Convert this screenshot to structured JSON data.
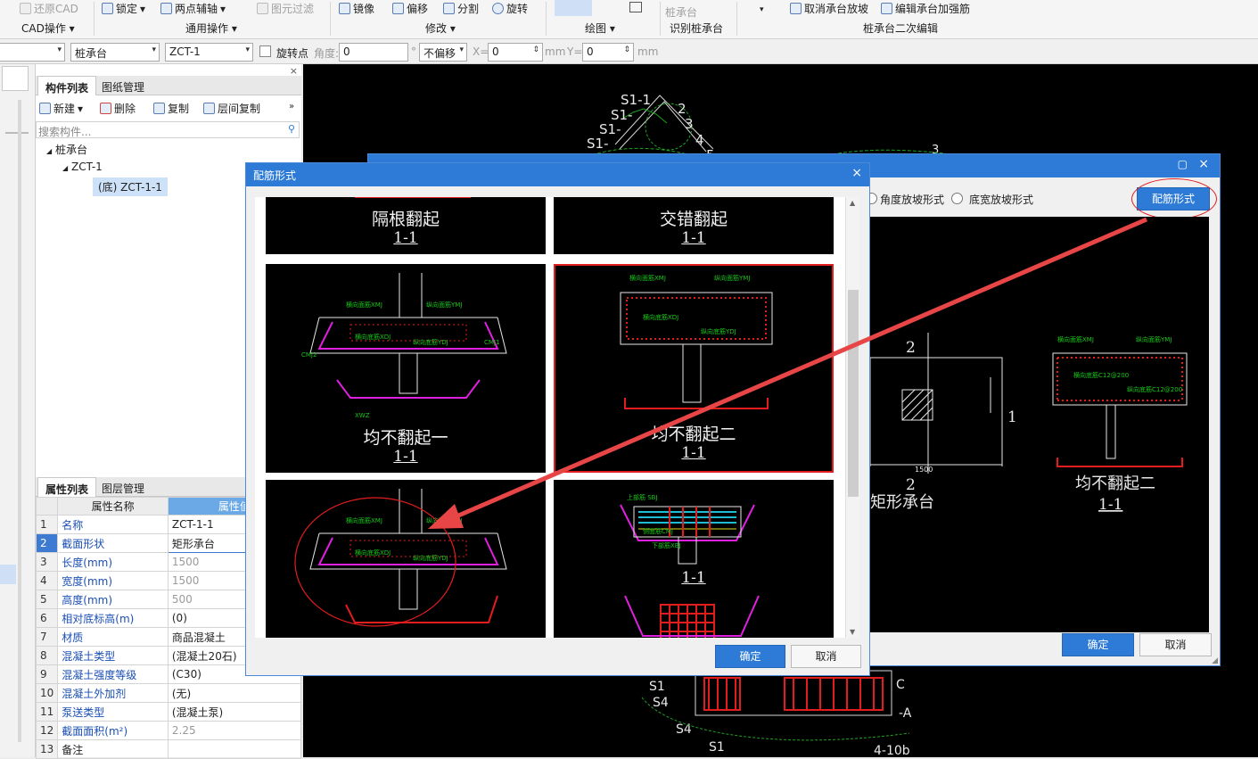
{
  "ribbon": {
    "items": [
      {
        "label": "还原CAD",
        "dim": true
      },
      {
        "label": "锁定",
        "dim": false
      },
      {
        "label": "两点辅轴",
        "dim": false
      },
      {
        "label": "图元过滤",
        "dim": true
      },
      {
        "label": "镜像",
        "dim": false
      },
      {
        "label": "偏移",
        "dim": false
      },
      {
        "label": "分割",
        "dim": false
      },
      {
        "label": "旋转",
        "dim": false
      },
      {
        "label": "桩承台",
        "dim": true
      },
      {
        "label": "取消承台放坡",
        "dim": false
      },
      {
        "label": "编辑承台加强筋",
        "dim": false
      }
    ],
    "groups": [
      "CAD操作",
      "通用操作",
      "修改",
      "绘图",
      "识别桩承台",
      "桩承台二次编辑"
    ]
  },
  "propbar": {
    "layer_combo": "桩承台",
    "comp_combo": "ZCT-1",
    "rotate_label": "旋转点",
    "angle_label": "角度:",
    "angle_value": "0",
    "offset_combo": "不偏移",
    "x_label": "X=",
    "x_value": "0",
    "y_label": "Y=",
    "y_value": "0",
    "unit": "mm"
  },
  "left": {
    "tabs": [
      "构件列表",
      "图纸管理"
    ],
    "toolbar": {
      "new": "新建",
      "delete": "删除",
      "copy": "复制",
      "floor_copy": "层间复制"
    },
    "search_placeholder": "搜索构件...",
    "tree": [
      "桩承台",
      "ZCT-1",
      "(底) ZCT-1-1"
    ],
    "prop_tabs": [
      "属性列表",
      "图层管理"
    ],
    "prop_headers": {
      "name": "属性名称",
      "value": "属性值"
    },
    "props": [
      {
        "n": "1",
        "name": "名称",
        "value": "ZCT-1-1",
        "gray": false,
        "plain": false
      },
      {
        "n": "2",
        "name": "截面形状",
        "value": "矩形承台",
        "gray": false,
        "plain": false
      },
      {
        "n": "3",
        "name": "长度(mm)",
        "value": "1500",
        "gray": true,
        "plain": false
      },
      {
        "n": "4",
        "name": "宽度(mm)",
        "value": "1500",
        "gray": true,
        "plain": false
      },
      {
        "n": "5",
        "name": "高度(mm)",
        "value": "500",
        "gray": true,
        "plain": false
      },
      {
        "n": "6",
        "name": "相对底标高(m)",
        "value": "(0)",
        "gray": false,
        "plain": false
      },
      {
        "n": "7",
        "name": "材质",
        "value": "商品混凝土",
        "gray": false,
        "plain": false
      },
      {
        "n": "8",
        "name": "混凝土类型",
        "value": "(混凝土20石)",
        "gray": false,
        "plain": false
      },
      {
        "n": "9",
        "name": "混凝土强度等级",
        "value": "(C30)",
        "gray": false,
        "plain": false
      },
      {
        "n": "10",
        "name": "混凝土外加剂",
        "value": "(无)",
        "gray": false,
        "plain": false
      },
      {
        "n": "11",
        "name": "泵送类型",
        "value": "(混凝土泵)",
        "gray": false,
        "plain": false
      },
      {
        "n": "12",
        "name": "截面面积(m²)",
        "value": "2.25",
        "gray": true,
        "plain": false
      },
      {
        "n": "13",
        "name": "备注",
        "value": "",
        "gray": false,
        "plain": true
      }
    ]
  },
  "back_dialog": {
    "radio1": "角度放坡形式",
    "radio2": "底宽放坡形式",
    "rebar_button": "配筋形式",
    "ok": "确定",
    "cancel": "取消",
    "preview": {
      "dim_top": "2",
      "dim_bottom": "2",
      "dim_right": "1",
      "width_dim": "1500",
      "shape_label": "矩形承台",
      "detail_title": "均不翻起二",
      "detail_sub": "1-1"
    }
  },
  "front_dialog": {
    "title": "配筋形式",
    "ok": "确定",
    "cancel": "取消",
    "tiles": [
      {
        "cap": "隔根翻起",
        "sub": "1-1"
      },
      {
        "cap": "交错翻起",
        "sub": "1-1"
      },
      {
        "cap": "均不翻起一",
        "sub": "1-1"
      },
      {
        "cap": "均不翻起二",
        "sub": "1-1"
      },
      {
        "cap": "",
        "sub": ""
      },
      {
        "cap": "",
        "sub": "1-1"
      }
    ],
    "rebar_tags": {
      "top": "横向面筋XMJ",
      "long_top": "纵向面筋YMJ",
      "bottom": "横向底筋XDJ",
      "long_bottom": "纵向底筋YDJ",
      "side": "侧面筋CMJ"
    }
  },
  "colors": {
    "accent": "#2d7bd6",
    "red": "#e31d1d",
    "cad_green": "#18c918",
    "cad_magenta": "#e020e0"
  }
}
